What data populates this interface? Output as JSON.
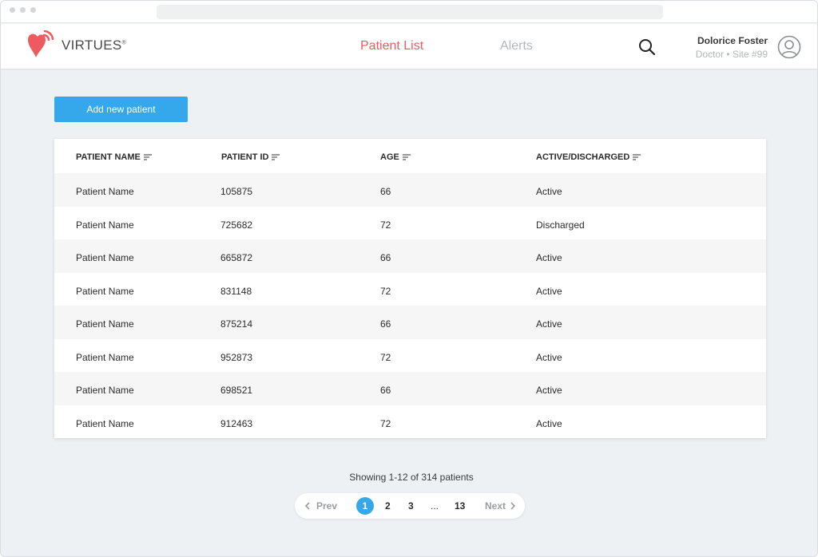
{
  "app": {
    "logo_text": "VIRTUES",
    "logo_mark": "®"
  },
  "nav": {
    "tabs": [
      {
        "label": "Patient List",
        "active": true
      },
      {
        "label": "Alerts",
        "active": false
      }
    ]
  },
  "user": {
    "name": "Dolorice Foster",
    "role": "Doctor • Site #99"
  },
  "actions": {
    "add_patient_label": "Add new patient"
  },
  "table": {
    "headers": [
      "PATIENT NAME",
      "PATIENT ID",
      "AGE",
      "ACTIVE/DISCHARGED"
    ],
    "rows": [
      [
        "Patient Name",
        "105875",
        "66",
        "Active"
      ],
      [
        "Patient Name",
        "725682",
        "72",
        "Discharged"
      ],
      [
        "Patient Name",
        "665872",
        "66",
        "Active"
      ],
      [
        "Patient Name",
        "831148",
        "72",
        "Active"
      ],
      [
        "Patient Name",
        "875214",
        "66",
        "Active"
      ],
      [
        "Patient Name",
        "952873",
        "72",
        "Active"
      ],
      [
        "Patient Name",
        "698521",
        "66",
        "Active"
      ],
      [
        "Patient Name",
        "912463",
        "72",
        "Active"
      ]
    ]
  },
  "pagination": {
    "summary": "Showing 1-12 of 314 patients",
    "prev_label": "Prev",
    "next_label": "Next",
    "pages": [
      "1",
      "2",
      "3",
      "...",
      "13"
    ],
    "current_page": "1"
  },
  "colors": {
    "accent": "#ef5a61",
    "primary_button": "#35a8ec",
    "background": "#edf1f4"
  }
}
